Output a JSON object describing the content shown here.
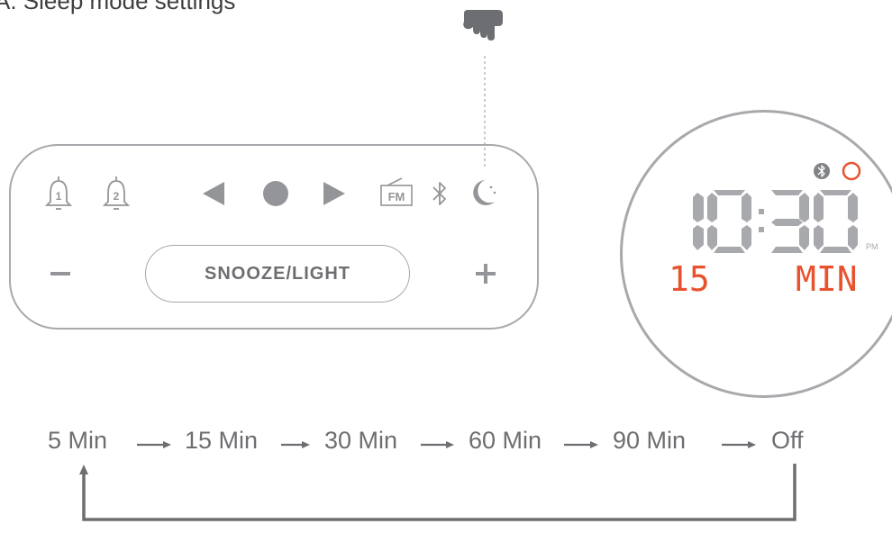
{
  "heading": "A. Sleep mode settings",
  "control_panel": {
    "icons": [
      "alarm-1-icon",
      "alarm-2-icon",
      "previous-icon",
      "play-pause-icon",
      "next-icon",
      "fm-radio-icon",
      "bluetooth-icon",
      "sleep-moon-icon",
      "minus-icon",
      "plus-icon"
    ],
    "alarm_1_number": "1",
    "alarm_2_number": "2",
    "fm_label": "FM",
    "snooze_label": "SNOOZE/LIGHT",
    "minus_label": "−",
    "plus_label": "+",
    "pointer": "hand-pointer-icon"
  },
  "display": {
    "time": "10:30",
    "pm_label": "PM",
    "timer_value": "15",
    "timer_unit": "MIN",
    "status_icons": [
      "bluetooth-icon",
      "sleep-icon"
    ],
    "accent_color": "#e8532f"
  },
  "cycle": {
    "steps": [
      "5 Min",
      "15 Min",
      "30 Min",
      "60 Min",
      "90 Min",
      "Off"
    ]
  },
  "colors": {
    "line": "#a7a9ac",
    "icon": "#939598",
    "text": "#6d6e71",
    "accent": "#e8532f"
  }
}
